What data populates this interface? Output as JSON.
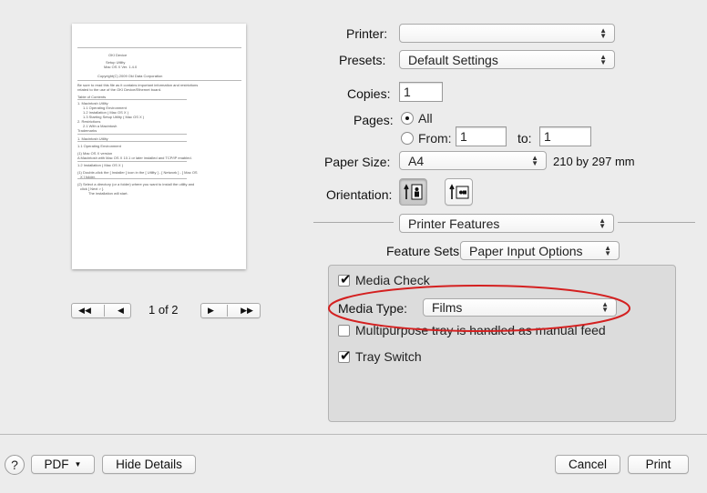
{
  "preview": {
    "doc_lines": [
      "OKI Device",
      "Setup Utility",
      "Mac OS X Ver. 1.4.0",
      "Copyright(C) 2009 Oki Data Corporation",
      "Be sure to read this file as it contains important information and restrictions",
      "related to the use of the OKI Device/Ethernet board.",
      "Table of Contents",
      "1. Macintosh Utility",
      "1.1 Operating Environment",
      "1.2 Installation ( Mac OS X )",
      "1.3 Starting Setup Utility ( Mac OS X )",
      "2. Restrictions",
      "2.1 With a Macintosh",
      "Trademarks",
      "1. Macintosh Utility",
      "1.1 Operating Environment",
      "(1) Mac OS X version",
      "A Macintosh with Mac OS X 10.1 or later installed and TCP/IP enabled.",
      "1.2 Installation ( Mac OS X )",
      "(1) Double-click the [ Installer ] icon in the [ Utility ] - [ Network ] - [ Mac OS",
      "X ] folder.",
      "(2) Select a directory (or a folder) where you want to install the utility and",
      "click [ Next > ].",
      "The installation will start."
    ],
    "page_indicator": "1 of 2"
  },
  "form": {
    "printer_label": "Printer:",
    "printer_value": "",
    "presets_label": "Presets:",
    "presets_value": "Default Settings",
    "copies_label": "Copies:",
    "copies_value": "1",
    "pages_label": "Pages:",
    "pages_all": "All",
    "pages_from": "From:",
    "pages_from_value": "1",
    "pages_to": "to:",
    "pages_to_value": "1",
    "paper_size_label": "Paper Size:",
    "paper_size_value": "A4",
    "paper_size_dims": "210 by 297 mm",
    "orientation_label": "Orientation:",
    "section_value": "Printer Features",
    "feature_sets_label": "Feature Sets:",
    "feature_sets_value": "Paper Input Options"
  },
  "features": {
    "media_check": "Media Check",
    "media_type_label": "Media Type:",
    "media_type_value": "Films",
    "multipurpose": "Multipurpose tray is handled as manual feed",
    "tray_switch": "Tray Switch"
  },
  "bottom": {
    "help": "?",
    "pdf": "PDF",
    "hide_details": "Hide Details",
    "cancel": "Cancel",
    "print": "Print"
  },
  "colors": {
    "highlight_ellipse": "#d42020"
  }
}
